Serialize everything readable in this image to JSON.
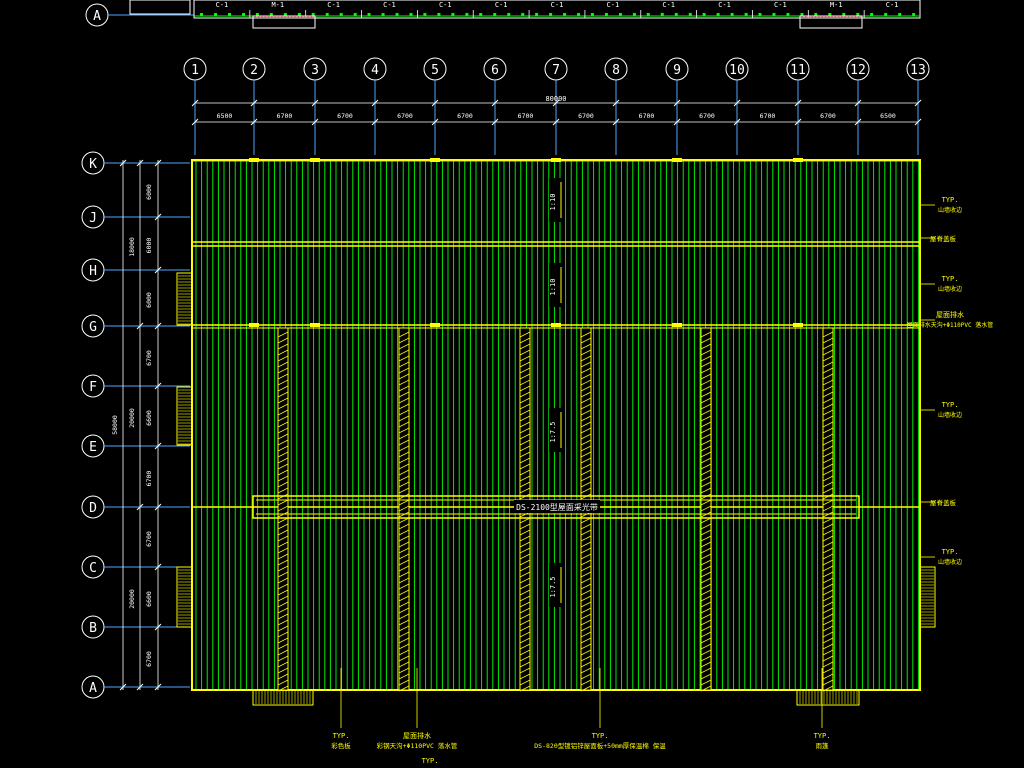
{
  "colors": {
    "background": "#000000",
    "axis_circle": "#ffffff",
    "axis_line": "#4da6ff",
    "outline": "#ffff00",
    "sheet": "#00ff00",
    "dim": "#ffffff",
    "annotation": "#ffff00",
    "top_elev": "#ffffff"
  },
  "top_elevation": {
    "axis_label": "A",
    "panels": [
      "C-1",
      "M-1",
      "C-1",
      "C-1",
      "C-1",
      "C-1",
      "C-1",
      "C-1",
      "C-1",
      "C-1",
      "C-1",
      "M-1",
      "C-1"
    ]
  },
  "columns": {
    "labels": [
      "1",
      "2",
      "3",
      "4",
      "5",
      "6",
      "7",
      "8",
      "9",
      "10",
      "11",
      "12",
      "13"
    ],
    "spacings": [
      "6500",
      "6700",
      "6700",
      "6700",
      "6700",
      "6700",
      "6700",
      "6700",
      "6700",
      "6700",
      "6700",
      "6500"
    ],
    "total": "80000"
  },
  "rows": {
    "labels": [
      "K",
      "J",
      "H",
      "G",
      "F",
      "E",
      "D",
      "C",
      "B",
      "A"
    ],
    "spacings": [
      "6000",
      "6000",
      "6000",
      "6700",
      "6600",
      "6700",
      "6700",
      "6600",
      "6700"
    ],
    "group_totals": [
      "18000",
      "20000",
      "20000"
    ],
    "overall": "58000"
  },
  "slopes": [
    "1:10",
    "1:10",
    "1:7.5",
    "1:7.5"
  ],
  "skylight_label": "DS-2100型屋面采光带",
  "right_notes": [
    {
      "line1": "TYP.",
      "line2": "山墙收边"
    },
    {
      "line1": "屋脊盖板",
      "line2": ""
    },
    {
      "line1": "TYP.",
      "line2": "山墙收边"
    },
    {
      "line1": "屋面排水",
      "line2": "屋面排水天沟+Φ110PVC 落水管"
    },
    {
      "line1": "TYP.",
      "line2": "山墙收边"
    },
    {
      "line1": "屋脊盖板",
      "line2": ""
    },
    {
      "line1": "TYP.",
      "line2": "山墙收边"
    }
  ],
  "bottom_notes": [
    {
      "line1": "TYP.",
      "line2": "彩色板"
    },
    {
      "line1": "屋面排水",
      "line2": "彩钢天沟+Φ110PVC 落水管"
    },
    {
      "line1": "TYP.",
      "line2": "DS-820型镀铝锌屋面板+50mm厚保温棉 保温"
    },
    {
      "line1": "TYP.",
      "line2": "雨篷"
    }
  ],
  "bottom_extra": "TYP."
}
